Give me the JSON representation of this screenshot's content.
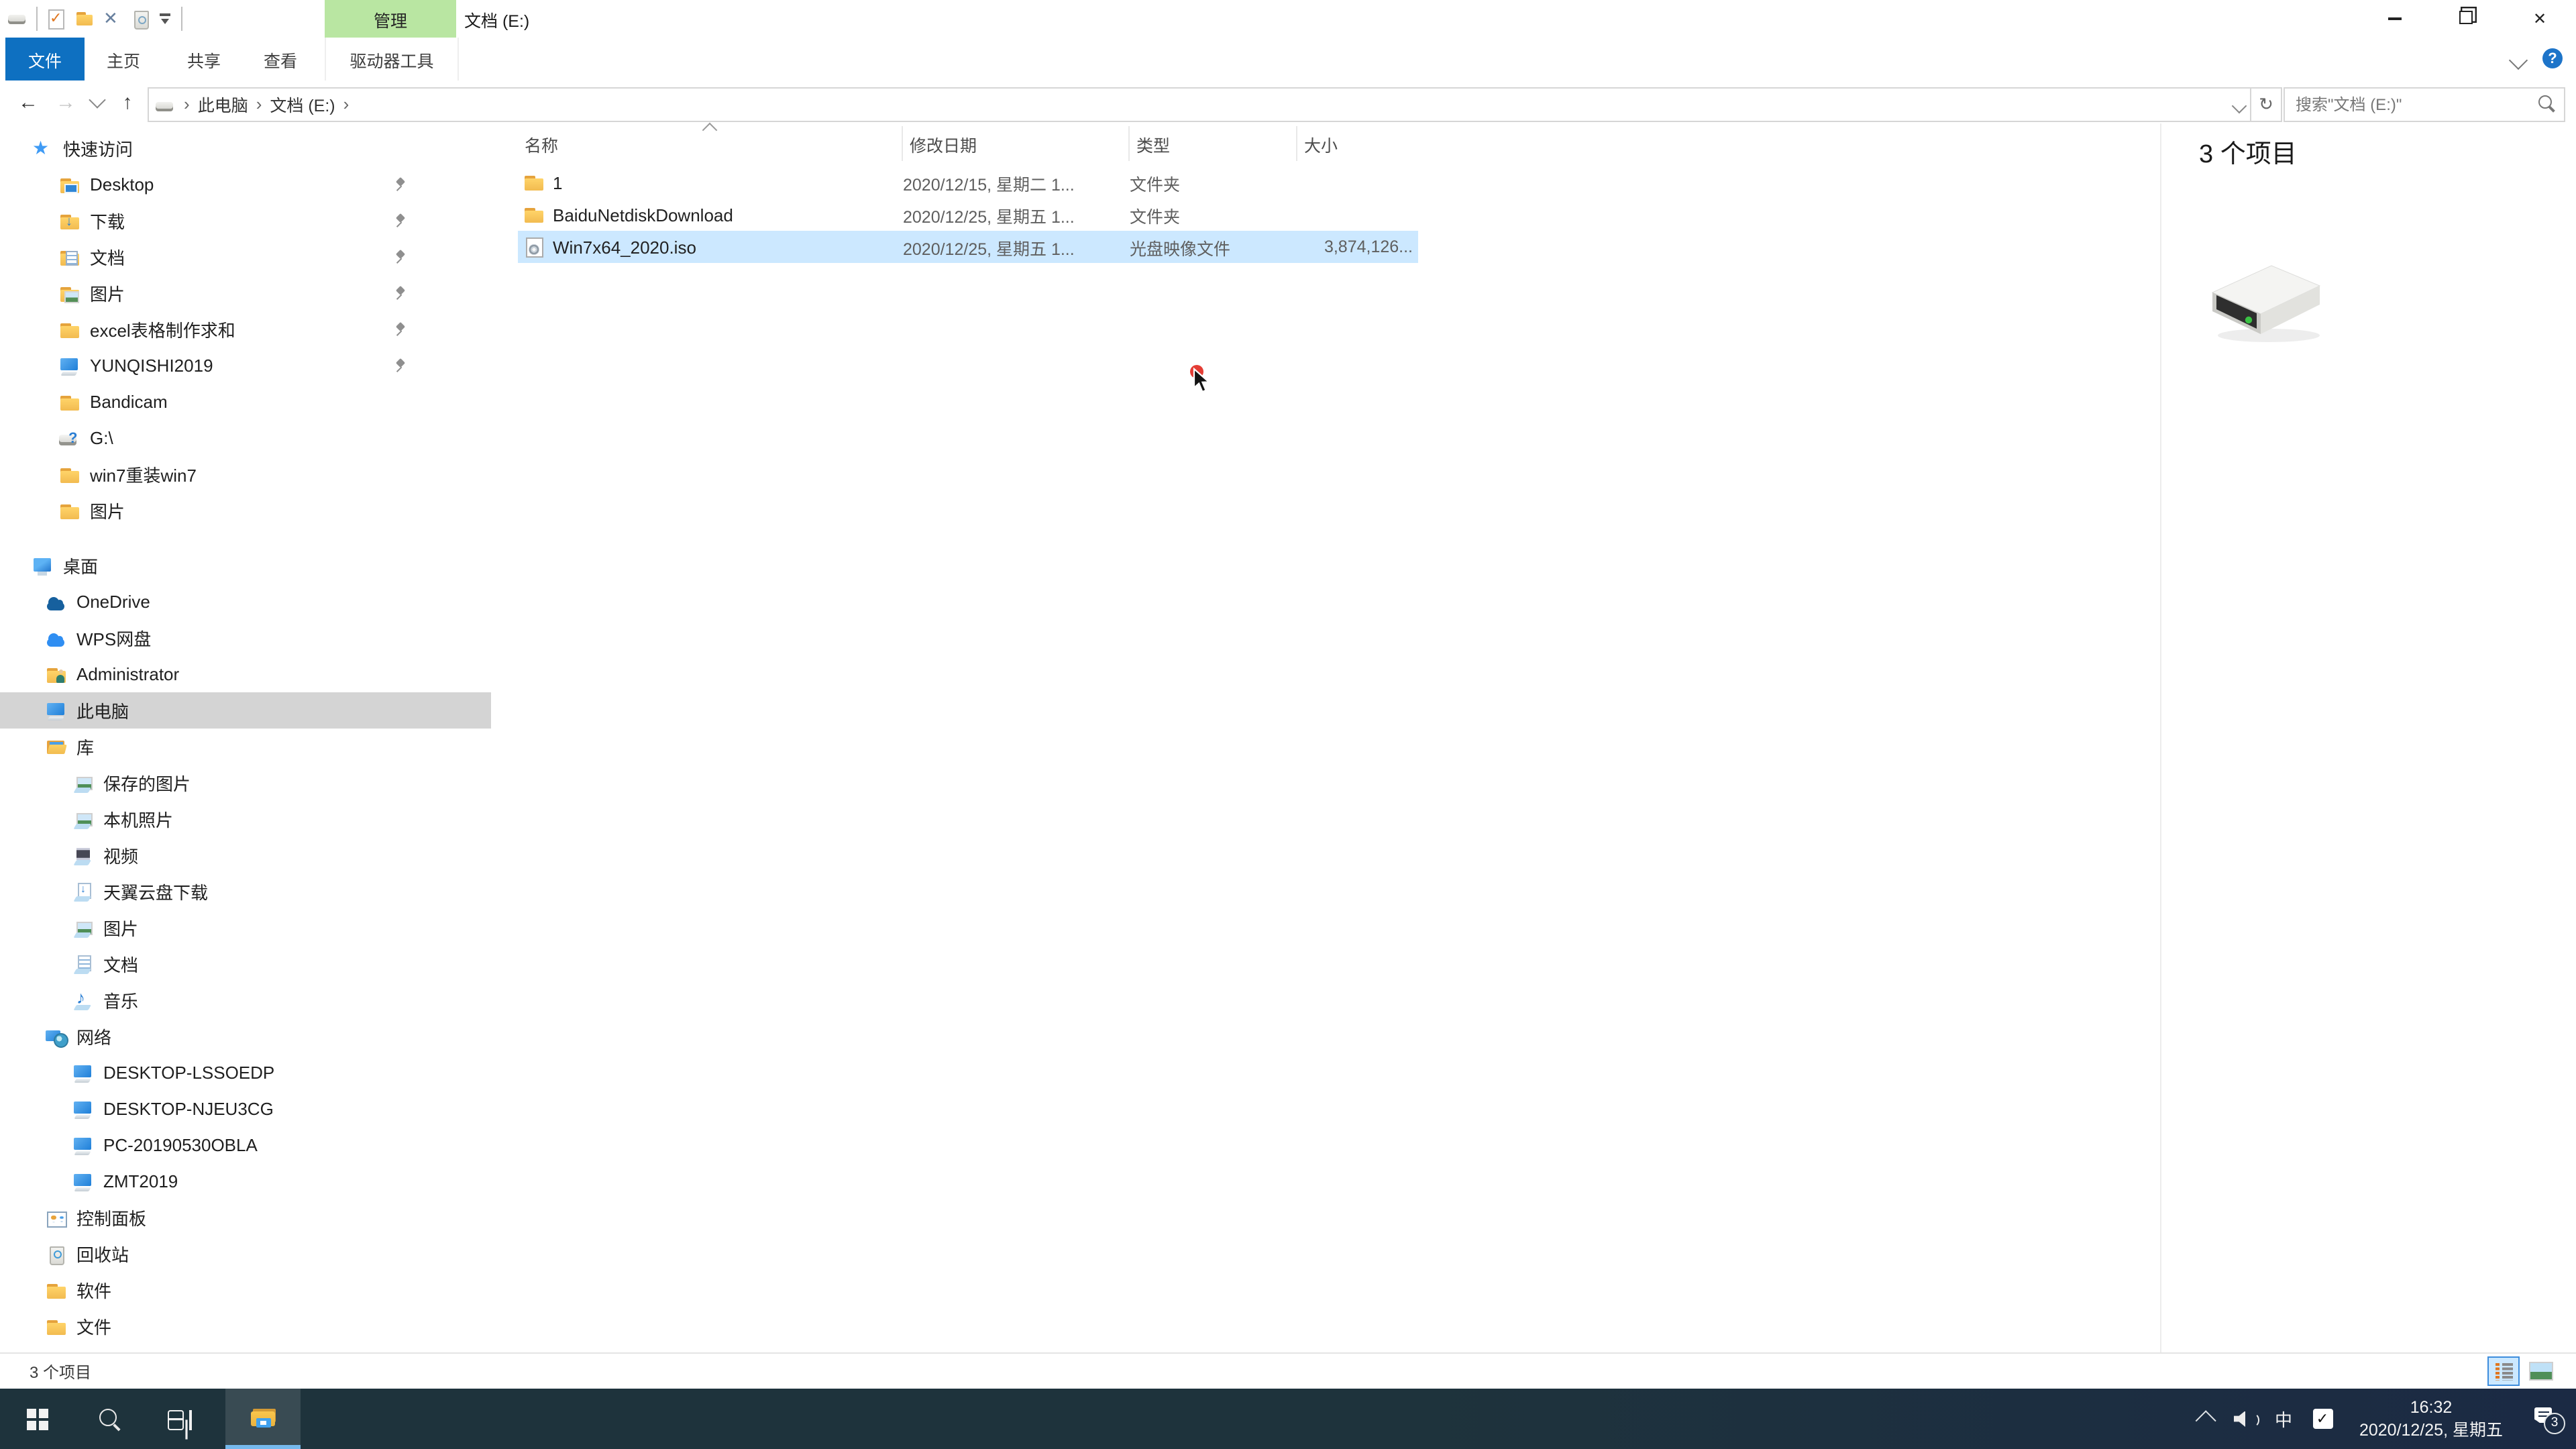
{
  "window": {
    "title": "文档 (E:)",
    "contextual_group": "管理",
    "qat_icons": [
      "drive-icon",
      "properties-check-icon",
      "new-folder-icon",
      "delete-icon",
      "recycle-bin-icon",
      "customize-dropdown-icon"
    ],
    "controls": {
      "minimize": "minimize",
      "restore": "restore",
      "close": "close"
    }
  },
  "ribbon": {
    "file_tab": "文件",
    "tabs": [
      "主页",
      "共享",
      "查看"
    ],
    "contextual_tab": "驱动器工具",
    "help_label": "?",
    "accent_green": "#b9e6a2",
    "file_tab_blue": "#0e70c1"
  },
  "navbar": {
    "breadcrumb": [
      "此电脑",
      "文档 (E:)"
    ],
    "search_placeholder": "搜索\"文档 (E:)\""
  },
  "sidebar": {
    "items": [
      {
        "label": "快速访问",
        "icon": "star",
        "indent": 24
      },
      {
        "label": "Desktop",
        "icon": "fld dsk",
        "indent": 44,
        "pinned": true
      },
      {
        "label": "下载",
        "icon": "fld dl",
        "indent": 44,
        "pinned": true
      },
      {
        "label": "文档",
        "icon": "fld doc",
        "indent": 44,
        "pinned": true
      },
      {
        "label": "图片",
        "icon": "fld pic",
        "indent": 44,
        "pinned": true
      },
      {
        "label": "excel表格制作求和",
        "icon": "fld",
        "indent": 44,
        "pinned": true
      },
      {
        "label": "YUNQISHI2019",
        "icon": "mon",
        "indent": 44,
        "pinned": true
      },
      {
        "label": "Bandicam",
        "icon": "fld",
        "indent": 44
      },
      {
        "label": "G:\\",
        "icon": "drvq",
        "indent": 44
      },
      {
        "label": "win7重装win7",
        "icon": "fld",
        "indent": 44
      },
      {
        "label": "图片",
        "icon": "fld",
        "indent": 44
      },
      {
        "label": "桌面",
        "icon": "desk",
        "indent": 24,
        "gap": 14
      },
      {
        "label": "OneDrive",
        "icon": "cl1",
        "indent": 34
      },
      {
        "label": "WPS网盘",
        "icon": "cl2",
        "indent": 34
      },
      {
        "label": "Administrator",
        "icon": "fld usr",
        "indent": 34
      },
      {
        "label": "此电脑",
        "icon": "mon",
        "indent": 34,
        "selected": true
      },
      {
        "label": "库",
        "icon": "lib",
        "indent": 34
      },
      {
        "label": "保存的图片",
        "icon": "limg lbase",
        "indent": 54
      },
      {
        "label": "本机照片",
        "icon": "limg lbase",
        "indent": 54
      },
      {
        "label": "视频",
        "icon": "lvid lbase",
        "indent": 54
      },
      {
        "label": "天翼云盘下载",
        "icon": "ldl lbase",
        "indent": 54
      },
      {
        "label": "图片",
        "icon": "limg lbase",
        "indent": 54
      },
      {
        "label": "文档",
        "icon": "ldoc lbase",
        "indent": 54
      },
      {
        "label": "音乐",
        "icon": "lmus lbase",
        "indent": 54
      },
      {
        "label": "网络",
        "icon": "net",
        "indent": 34
      },
      {
        "label": "DESKTOP-LSSOEDP",
        "icon": "mon",
        "indent": 54
      },
      {
        "label": "DESKTOP-NJEU3CG",
        "icon": "mon",
        "indent": 54
      },
      {
        "label": "PC-20190530OBLA",
        "icon": "mon",
        "indent": 54
      },
      {
        "label": "ZMT2019",
        "icon": "mon",
        "indent": 54
      },
      {
        "label": "控制面板",
        "icon": "ctrl",
        "indent": 34
      },
      {
        "label": "回收站",
        "icon": "rec",
        "indent": 34
      },
      {
        "label": "软件",
        "icon": "fld",
        "indent": 34
      },
      {
        "label": "文件",
        "icon": "fld",
        "indent": 34
      }
    ]
  },
  "filelist": {
    "columns": [
      "名称",
      "修改日期",
      "类型",
      "大小"
    ],
    "rows": [
      {
        "name": "1",
        "icon": "fld",
        "date": "2020/12/15, 星期二 1...",
        "type": "文件夹",
        "size": ""
      },
      {
        "name": "BaiduNetdiskDownload",
        "icon": "fld",
        "date": "2020/12/25, 星期五 1...",
        "type": "文件夹",
        "size": ""
      },
      {
        "name": "Win7x64_2020.iso",
        "icon": "iso",
        "date": "2020/12/25, 星期五 1...",
        "type": "光盘映像文件",
        "size": "3,874,126...",
        "selected": true
      }
    ],
    "selection_color": "#cce8ff"
  },
  "details_pane": {
    "item_count": "3 个项目",
    "drive_icon": "external-drive-icon"
  },
  "statusbar": {
    "item_count": "3 个项目",
    "view_buttons": [
      "details-view",
      "large-thumbnails-view"
    ]
  },
  "taskbar": {
    "buttons": [
      "start",
      "search",
      "task-view",
      "file-explorer"
    ],
    "active_button": "file-explorer",
    "tray": {
      "ime": "中",
      "time": "16:32",
      "date": "2020/12/25, 星期五",
      "notification_badge": "3"
    }
  }
}
